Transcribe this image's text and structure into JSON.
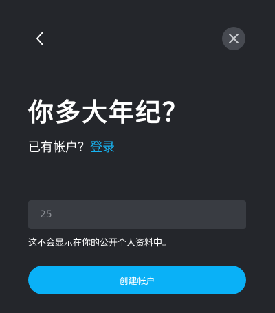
{
  "dialog": {
    "title": "你多大年纪？",
    "subtitle_prefix": "已有帐户？",
    "login_link": "登录",
    "age_input": {
      "value": "",
      "placeholder": "25"
    },
    "hint": "这不会显示在你的公开个人资料中。",
    "create_button": "创建帐户"
  },
  "icons": {
    "back": "chevron-left-icon",
    "close": "close-icon"
  },
  "colors": {
    "background": "#24262b",
    "accent": "#0ab1f7",
    "link": "#17b2f0",
    "input_bg": "#393c42",
    "close_bg": "#474a51"
  }
}
